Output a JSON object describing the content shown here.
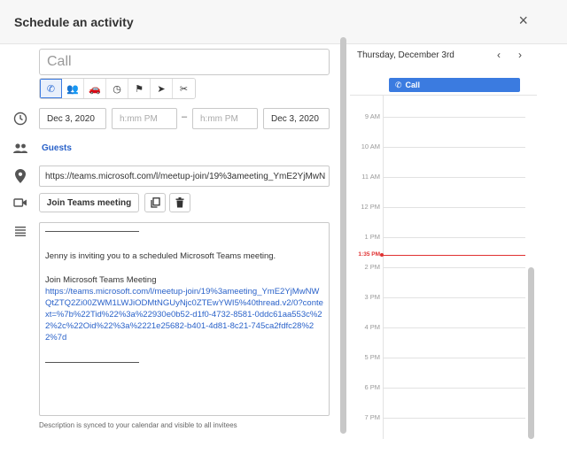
{
  "dialog": {
    "title": "Schedule an activity",
    "close_glyph": "×"
  },
  "form": {
    "title_placeholder": "Call",
    "activity_types": [
      {
        "name": "call-icon",
        "glyph": "✆",
        "active": true
      },
      {
        "name": "meeting-icon",
        "glyph": "👥",
        "active": false
      },
      {
        "name": "car-icon",
        "glyph": "🚗",
        "active": false
      },
      {
        "name": "clock-icon",
        "glyph": "◷",
        "active": false
      },
      {
        "name": "flag-icon",
        "glyph": "⚑",
        "active": false
      },
      {
        "name": "send-icon",
        "glyph": "➤",
        "active": false
      },
      {
        "name": "lunch-icon",
        "glyph": "✂",
        "active": false
      }
    ],
    "start_date": "Dec 3, 2020",
    "start_time_placeholder": "h:mm PM",
    "end_time_placeholder": "h:mm PM",
    "end_date": "Dec 3, 2020",
    "dash": "–",
    "guests_label": "Guests",
    "meeting_url": "https://teams.microsoft.com/l/meetup-join/19%3ameeting_YmE2YjMwN",
    "join_button": "Join Teams meeting",
    "description": {
      "invite_text": "Jenny is inviting you to a scheduled Microsoft Teams meeting.",
      "join_heading": "Join Microsoft Teams Meeting",
      "join_link": "https://teams.microsoft.com/l/meetup-join/19%3ameeting_YmE2YjMwNWQtZTQ2Zi00ZWM1LWJiODMtNGUyNjc0ZTEwYWI5%40thread.v2/0?context=%7b%22Tid%22%3a%22930e0b52-d1f0-4732-8581-0ddc61aa553c%22%2c%22Oid%22%3a%2221e25682-b401-4d81-8c21-745ca2fdfc28%22%7d"
    },
    "hint": "Description is synced to your calendar and visible to all invitees"
  },
  "calendar": {
    "date_label": "Thursday, December 3rd",
    "prev_glyph": "‹",
    "next_glyph": "›",
    "all_day_event": "Call",
    "hours": [
      "9 AM",
      "10 AM",
      "11 AM",
      "12 PM",
      "1 PM",
      "2 PM",
      "3 PM",
      "4 PM",
      "5 PM",
      "6 PM",
      "7 PM"
    ],
    "now_label": "1:35 PM"
  }
}
